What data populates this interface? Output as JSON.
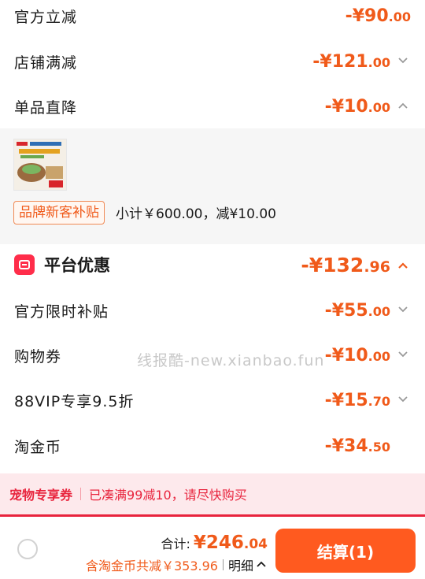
{
  "rows_top": [
    {
      "label": "官方立减",
      "amount_main": "-¥90",
      "amount_dec": ".00",
      "chevron": "none"
    },
    {
      "label": "店铺满减",
      "amount_main": "-¥121",
      "amount_dec": ".00",
      "chevron": "down"
    },
    {
      "label": "单品直降",
      "amount_main": "-¥10",
      "amount_dec": ".00",
      "chevron": "up"
    }
  ],
  "product": {
    "tag": "品牌新客补贴",
    "subtotal": "小计￥600.00，减¥10.00"
  },
  "platform": {
    "title": "平台优惠",
    "amount_main": "-¥132",
    "amount_dec": ".96",
    "chevron": "up"
  },
  "rows_platform": [
    {
      "label": "官方限时补贴",
      "amount_main": "-¥55",
      "amount_dec": ".00",
      "chevron": "down"
    },
    {
      "label": "购物券",
      "amount_main": "-¥10",
      "amount_dec": ".00",
      "chevron": "down"
    },
    {
      "label": "88VIP专享9.5折",
      "amount_main": "-¥15",
      "amount_dec": ".70",
      "chevron": "down"
    },
    {
      "label": "淘金币",
      "amount_main": "-¥34",
      "amount_dec": ".50",
      "chevron": "none"
    }
  ],
  "watermark": "线报酷-new.xianbao.fun",
  "notice": {
    "coupon": "宠物专享券",
    "message": "已凑满99减10，请尽快购买"
  },
  "footer": {
    "total_label": "合计:",
    "total_main": "¥246",
    "total_dec": ".04",
    "saved": "含淘金币共减￥353.96",
    "detail": "明细",
    "checkout": "结算(1)"
  },
  "colors": {
    "accent": "#f05a1a",
    "red": "#e8243d",
    "checkout": "#ff5a1f"
  }
}
